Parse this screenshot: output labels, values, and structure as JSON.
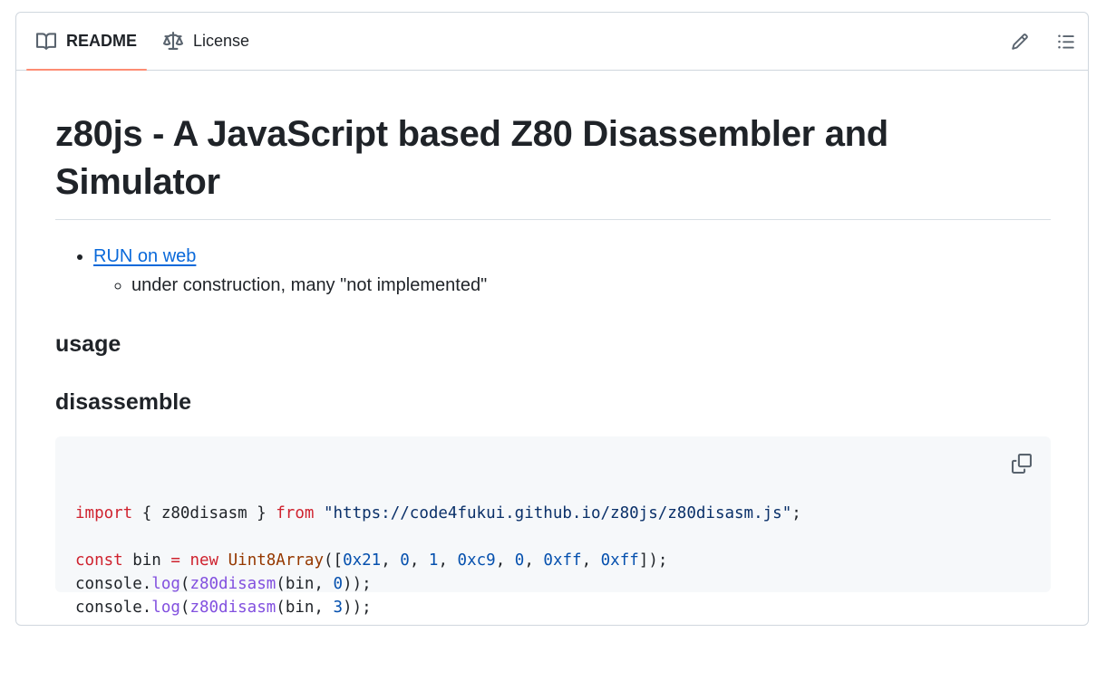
{
  "tabs": [
    {
      "label": "README",
      "icon": "book-icon",
      "active": true
    },
    {
      "label": "License",
      "icon": "scale-icon",
      "active": false
    }
  ],
  "actions": {
    "edit_icon": "pencil-icon",
    "outline_icon": "list-icon"
  },
  "readme": {
    "title": "z80js - A JavaScript based Z80 Disassembler and Simulator",
    "bullets": [
      {
        "link_text": "RUN on web",
        "sub_items": [
          "under construction, many \"not implemented\""
        ]
      }
    ],
    "heading_usage": "usage",
    "heading_disassemble": "disassemble",
    "code": {
      "copy_icon": "copy-icon",
      "lines": [
        [
          [
            "kw",
            "import"
          ],
          [
            "p",
            " { z80disasm } "
          ],
          [
            "kw",
            "from"
          ],
          [
            "p",
            " "
          ],
          [
            "str",
            "\"https://code4fukui.github.io/z80js/z80disasm.js\""
          ],
          [
            "p",
            ";"
          ]
        ],
        [],
        [
          [
            "kw",
            "const"
          ],
          [
            "p",
            " bin "
          ],
          [
            "kw",
            "="
          ],
          [
            "p",
            " "
          ],
          [
            "kw",
            "new"
          ],
          [
            "p",
            " "
          ],
          [
            "cls",
            "Uint8Array"
          ],
          [
            "p",
            "(["
          ],
          [
            "num",
            "0x21"
          ],
          [
            "p",
            ", "
          ],
          [
            "num",
            "0"
          ],
          [
            "p",
            ", "
          ],
          [
            "num",
            "1"
          ],
          [
            "p",
            ", "
          ],
          [
            "num",
            "0xc9"
          ],
          [
            "p",
            ", "
          ],
          [
            "num",
            "0"
          ],
          [
            "p",
            ", "
          ],
          [
            "num",
            "0xff"
          ],
          [
            "p",
            ", "
          ],
          [
            "num",
            "0xff"
          ],
          [
            "p",
            "]);"
          ]
        ],
        [
          [
            "p",
            "console."
          ],
          [
            "fn",
            "log"
          ],
          [
            "p",
            "("
          ],
          [
            "fn",
            "z80disasm"
          ],
          [
            "p",
            "(bin, "
          ],
          [
            "num",
            "0"
          ],
          [
            "p",
            "));"
          ]
        ],
        [
          [
            "p",
            "console."
          ],
          [
            "fn",
            "log"
          ],
          [
            "p",
            "("
          ],
          [
            "fn",
            "z80disasm"
          ],
          [
            "p",
            "(bin, "
          ],
          [
            "num",
            "3"
          ],
          [
            "p",
            "));"
          ]
        ]
      ]
    }
  },
  "colors": {
    "active_tab_underline": "#fd8c73",
    "link": "#0969da",
    "code_background": "#f6f8fa"
  }
}
